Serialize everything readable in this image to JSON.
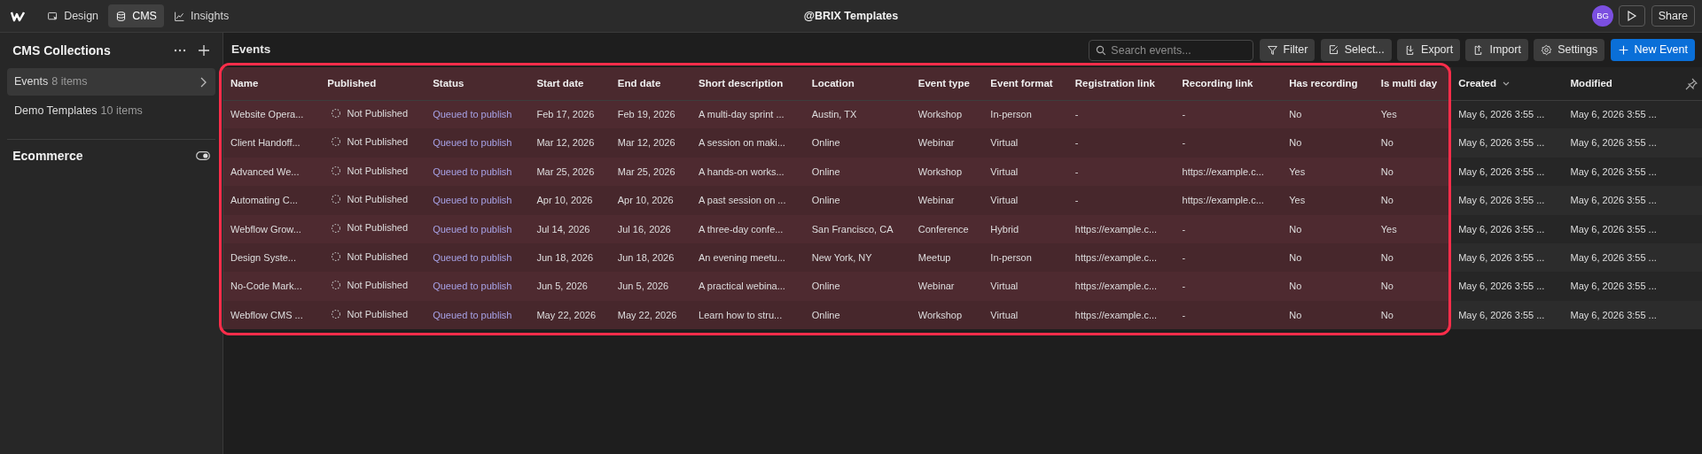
{
  "topbar": {
    "tabs": [
      {
        "label": "Design",
        "selected": false
      },
      {
        "label": "CMS",
        "selected": true
      },
      {
        "label": "Insights",
        "selected": false
      }
    ],
    "title": "@BRIX Templates",
    "avatar": "BG",
    "share": "Share"
  },
  "sidebar": {
    "title": "CMS Collections",
    "collections": [
      {
        "name": "Events",
        "count": "8 items",
        "selected": true
      },
      {
        "name": "Demo Templates",
        "count": "10 items",
        "selected": false
      }
    ],
    "section": "Ecommerce"
  },
  "main": {
    "title": "Events",
    "search": {
      "placeholder": "Search events..."
    },
    "buttons": [
      {
        "label": "Filter",
        "kind": "secondary"
      },
      {
        "label": "Select...",
        "kind": "secondary"
      },
      {
        "label": "Export",
        "kind": "secondary"
      },
      {
        "label": "Import",
        "kind": "secondary"
      },
      {
        "label": "Settings",
        "kind": "secondary"
      },
      {
        "label": "New Event",
        "kind": "primary"
      }
    ]
  },
  "table": {
    "columns": [
      {
        "label": "Name",
        "kind": "text",
        "highlighted": true,
        "sorted": false
      },
      {
        "label": "Published",
        "kind": "published",
        "highlighted": true,
        "sorted": false
      },
      {
        "label": "Status",
        "kind": "status",
        "highlighted": true,
        "sorted": false
      },
      {
        "label": "Start date",
        "kind": "text",
        "highlighted": true,
        "sorted": false
      },
      {
        "label": "End date",
        "kind": "text",
        "highlighted": true,
        "sorted": false
      },
      {
        "label": "Short description",
        "kind": "text",
        "highlighted": true,
        "sorted": false
      },
      {
        "label": "Location",
        "kind": "text",
        "highlighted": true,
        "sorted": false
      },
      {
        "label": "Event type",
        "kind": "text",
        "highlighted": true,
        "sorted": false
      },
      {
        "label": "Event format",
        "kind": "text",
        "highlighted": true,
        "sorted": false
      },
      {
        "label": "Registration link",
        "kind": "text",
        "highlighted": true,
        "sorted": false
      },
      {
        "label": "Recording link",
        "kind": "text",
        "highlighted": true,
        "sorted": false
      },
      {
        "label": "Has recording",
        "kind": "text",
        "highlighted": true,
        "sorted": false
      },
      {
        "label": "Is multi day",
        "kind": "text",
        "highlighted": true,
        "sorted": false
      },
      {
        "label": "Created",
        "kind": "text",
        "highlighted": false,
        "sorted": true
      },
      {
        "label": "Modified",
        "kind": "text",
        "highlighted": false,
        "sorted": false
      }
    ],
    "rows": [
      {
        "cells": [
          "Website Opera...",
          "Not Published",
          "Queued to publish",
          "Feb 17, 2026",
          "Feb 19, 2026",
          "A multi-day sprint ...",
          "Austin, TX",
          "Workshop",
          "In-person",
          "-",
          "-",
          "No",
          "Yes",
          "May 6, 2026 3:55 ...",
          "May 6, 2026 3:55 ..."
        ]
      },
      {
        "cells": [
          "Client Handoff...",
          "Not Published",
          "Queued to publish",
          "Mar 12, 2026",
          "Mar 12, 2026",
          "A session on maki...",
          "Online",
          "Webinar",
          "Virtual",
          "-",
          "-",
          "No",
          "No",
          "May 6, 2026 3:55 ...",
          "May 6, 2026 3:55 ..."
        ]
      },
      {
        "cells": [
          "Advanced We...",
          "Not Published",
          "Queued to publish",
          "Mar 25, 2026",
          "Mar 25, 2026",
          "A hands-on works...",
          "Online",
          "Workshop",
          "Virtual",
          "-",
          "https://example.c...",
          "Yes",
          "No",
          "May 6, 2026 3:55 ...",
          "May 6, 2026 3:55 ..."
        ]
      },
      {
        "cells": [
          "Automating C...",
          "Not Published",
          "Queued to publish",
          "Apr 10, 2026",
          "Apr 10, 2026",
          "A past session on ...",
          "Online",
          "Webinar",
          "Virtual",
          "-",
          "https://example.c...",
          "Yes",
          "No",
          "May 6, 2026 3:55 ...",
          "May 6, 2026 3:55 ..."
        ]
      },
      {
        "cells": [
          "Webflow Grow...",
          "Not Published",
          "Queued to publish",
          "Jul 14, 2026",
          "Jul 16, 2026",
          "A three-day confe...",
          "San Francisco, CA",
          "Conference",
          "Hybrid",
          "https://example.c...",
          "-",
          "No",
          "Yes",
          "May 6, 2026 3:55 ...",
          "May 6, 2026 3:55 ..."
        ]
      },
      {
        "cells": [
          "Design Syste...",
          "Not Published",
          "Queued to publish",
          "Jun 18, 2026",
          "Jun 18, 2026",
          "An evening meetu...",
          "New York, NY",
          "Meetup",
          "In-person",
          "https://example.c...",
          "-",
          "No",
          "No",
          "May 6, 2026 3:55 ...",
          "May 6, 2026 3:55 ..."
        ]
      },
      {
        "cells": [
          "No-Code Mark...",
          "Not Published",
          "Queued to publish",
          "Jun 5, 2026",
          "Jun 5, 2026",
          "A practical webina...",
          "Online",
          "Webinar",
          "Virtual",
          "https://example.c...",
          "-",
          "No",
          "No",
          "May 6, 2026 3:55 ...",
          "May 6, 2026 3:55 ..."
        ]
      },
      {
        "cells": [
          "Webflow CMS ...",
          "Not Published",
          "Queued to publish",
          "May 22, 2026",
          "May 22, 2026",
          "Learn how to stru...",
          "Online",
          "Workshop",
          "Virtual",
          "https://example.c...",
          "-",
          "No",
          "No",
          "May 6, 2026 3:55 ...",
          "May 6, 2026 3:55 ..."
        ]
      }
    ]
  }
}
